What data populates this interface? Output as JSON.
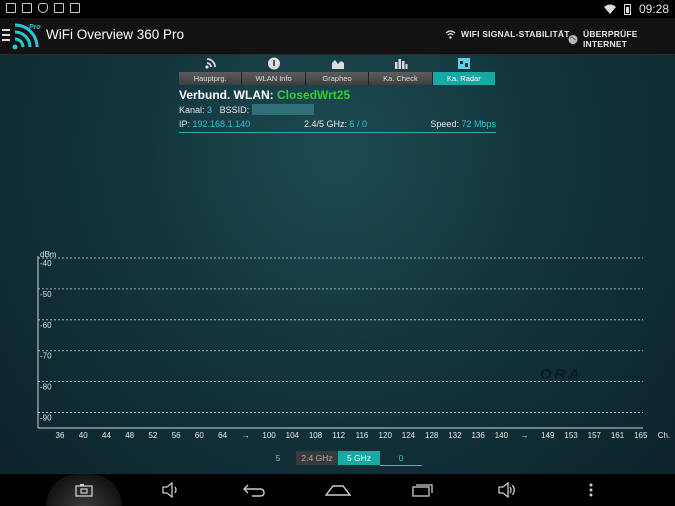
{
  "status_bar": {
    "time": "09:28"
  },
  "app": {
    "title": "WiFi Overview 360 Pro",
    "logo_badge": "Pro"
  },
  "actions": {
    "stability": "WIFI SIGNAL-STABILITÄT",
    "internet": "ÜBERPRÜFE INTERNET"
  },
  "tabs": [
    {
      "label": "Hauptprg.",
      "icon": "wifi-icon"
    },
    {
      "label": "WLAN Info",
      "icon": "info-icon"
    },
    {
      "label": "Grapheo",
      "icon": "graph-icon"
    },
    {
      "label": "Ka. Check",
      "icon": "bars-icon"
    },
    {
      "label": "Ka. Radar",
      "icon": "radar-icon",
      "active": true
    }
  ],
  "info": {
    "connected_label": "Verbund. WLAN:",
    "ssid": "ClosedWrt25",
    "kanal_label": "Kanal:",
    "kanal": "3",
    "bssid_label": "BSSID:",
    "ip_label": "IP:",
    "ip": "192.168.1.140",
    "ghz_label": "2.4/5 GHz:",
    "ghz": "6 / 0",
    "speed_label": "Speed:",
    "speed": "72 Mbps"
  },
  "chart_data": {
    "type": "line",
    "ylabel": "dBm",
    "y_ticks": [
      "-40",
      "-50",
      "-60",
      "-70",
      "-80",
      "-90"
    ],
    "ylim": [
      -95,
      -40
    ],
    "grid": true,
    "x_ticks": [
      "36",
      "40",
      "44",
      "48",
      "52",
      "56",
      "60",
      "64",
      "→",
      "100",
      "104",
      "108",
      "112",
      "116",
      "120",
      "124",
      "128",
      "132",
      "136",
      "140",
      "→",
      "149",
      "153",
      "157",
      "161",
      "165",
      "Ch."
    ],
    "series": []
  },
  "watermark": "ORA",
  "band_selector": {
    "left": "5",
    "band_24": "2.4 GHz",
    "band_5": "5 GHz",
    "count": "0"
  },
  "colors": {
    "accent": "#17a9a3",
    "value": "#27c6d4",
    "ssid": "#33cc33"
  }
}
